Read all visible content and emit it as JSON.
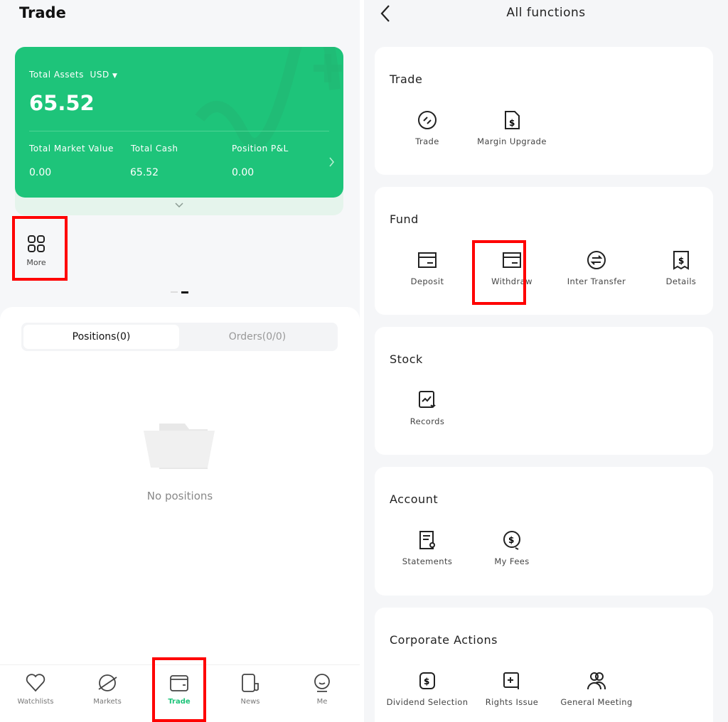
{
  "left": {
    "header_title": "Trade",
    "assets_card": {
      "label": "Total Assets",
      "currency": "USD",
      "total": "65.52",
      "stats": [
        {
          "label": "Total Market Value",
          "value": "0.00"
        },
        {
          "label": "Total Cash",
          "value": "65.52"
        },
        {
          "label": "Position P&L",
          "value": "0.00"
        }
      ]
    },
    "more_label": "More",
    "tabs": [
      {
        "label": "Positions(0)",
        "active": true
      },
      {
        "label": "Orders(0/0)",
        "active": false
      }
    ],
    "empty_text": "No positions",
    "bottom_nav": [
      {
        "label": "Watchlists",
        "icon": "heart-icon"
      },
      {
        "label": "Markets",
        "icon": "planet-icon"
      },
      {
        "label": "Trade",
        "icon": "wallet-icon",
        "active": true
      },
      {
        "label": "News",
        "icon": "newspaper-icon"
      },
      {
        "label": "Me",
        "icon": "avatar-icon"
      }
    ],
    "accent": "#1ec47a"
  },
  "right": {
    "title": "All functions",
    "sections": [
      {
        "title": "Trade",
        "items": [
          "Trade",
          "Margin Upgrade"
        ]
      },
      {
        "title": "Fund",
        "items": [
          "Deposit",
          "Withdraw",
          "Inter Transfer",
          "Details"
        ]
      },
      {
        "title": "Stock",
        "items": [
          "Records"
        ]
      },
      {
        "title": "Account",
        "items": [
          "Statements",
          "My Fees"
        ]
      },
      {
        "title": "Corporate Actions",
        "items": [
          "Dividend Selection",
          "Rights Issue",
          "General Meeting"
        ]
      }
    ]
  }
}
